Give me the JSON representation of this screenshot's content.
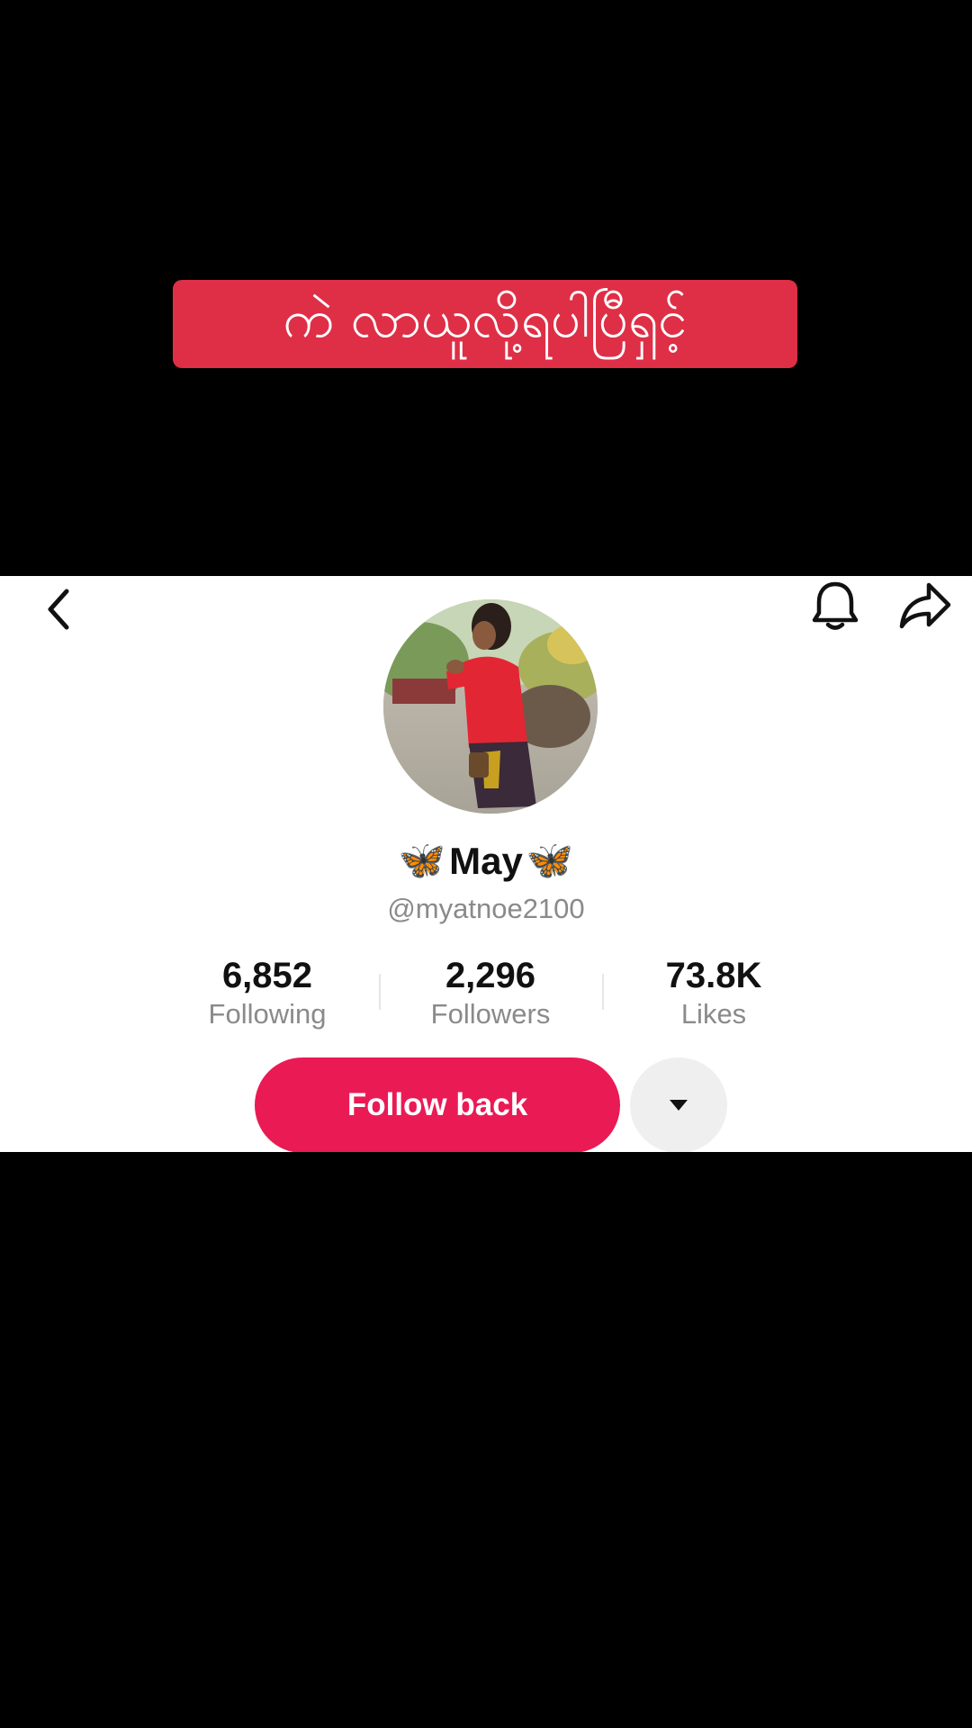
{
  "video_caption": "ကဲ လာယူလို့ရပါပြီရှင့်",
  "profile": {
    "display_name_left_emoji": "🦋",
    "display_name": "May",
    "display_name_right_emoji": "🦋",
    "username": "@myatnoe2100",
    "stats": {
      "following_value": "6,852",
      "following_label": "Following",
      "followers_value": "2,296",
      "followers_label": "Followers",
      "likes_value": "73.8K",
      "likes_label": "Likes"
    },
    "follow_button_label": "Follow back"
  },
  "icons": {
    "back": "chevron-left-icon",
    "bell": "bell-icon",
    "share": "share-arrow-icon",
    "more": "caret-down-icon"
  },
  "colors": {
    "caption_bg": "#de2f46",
    "follow_button": "#ea1a55",
    "secondary_text": "#8a8a8a",
    "name_emoji": "#2ea8e6"
  }
}
